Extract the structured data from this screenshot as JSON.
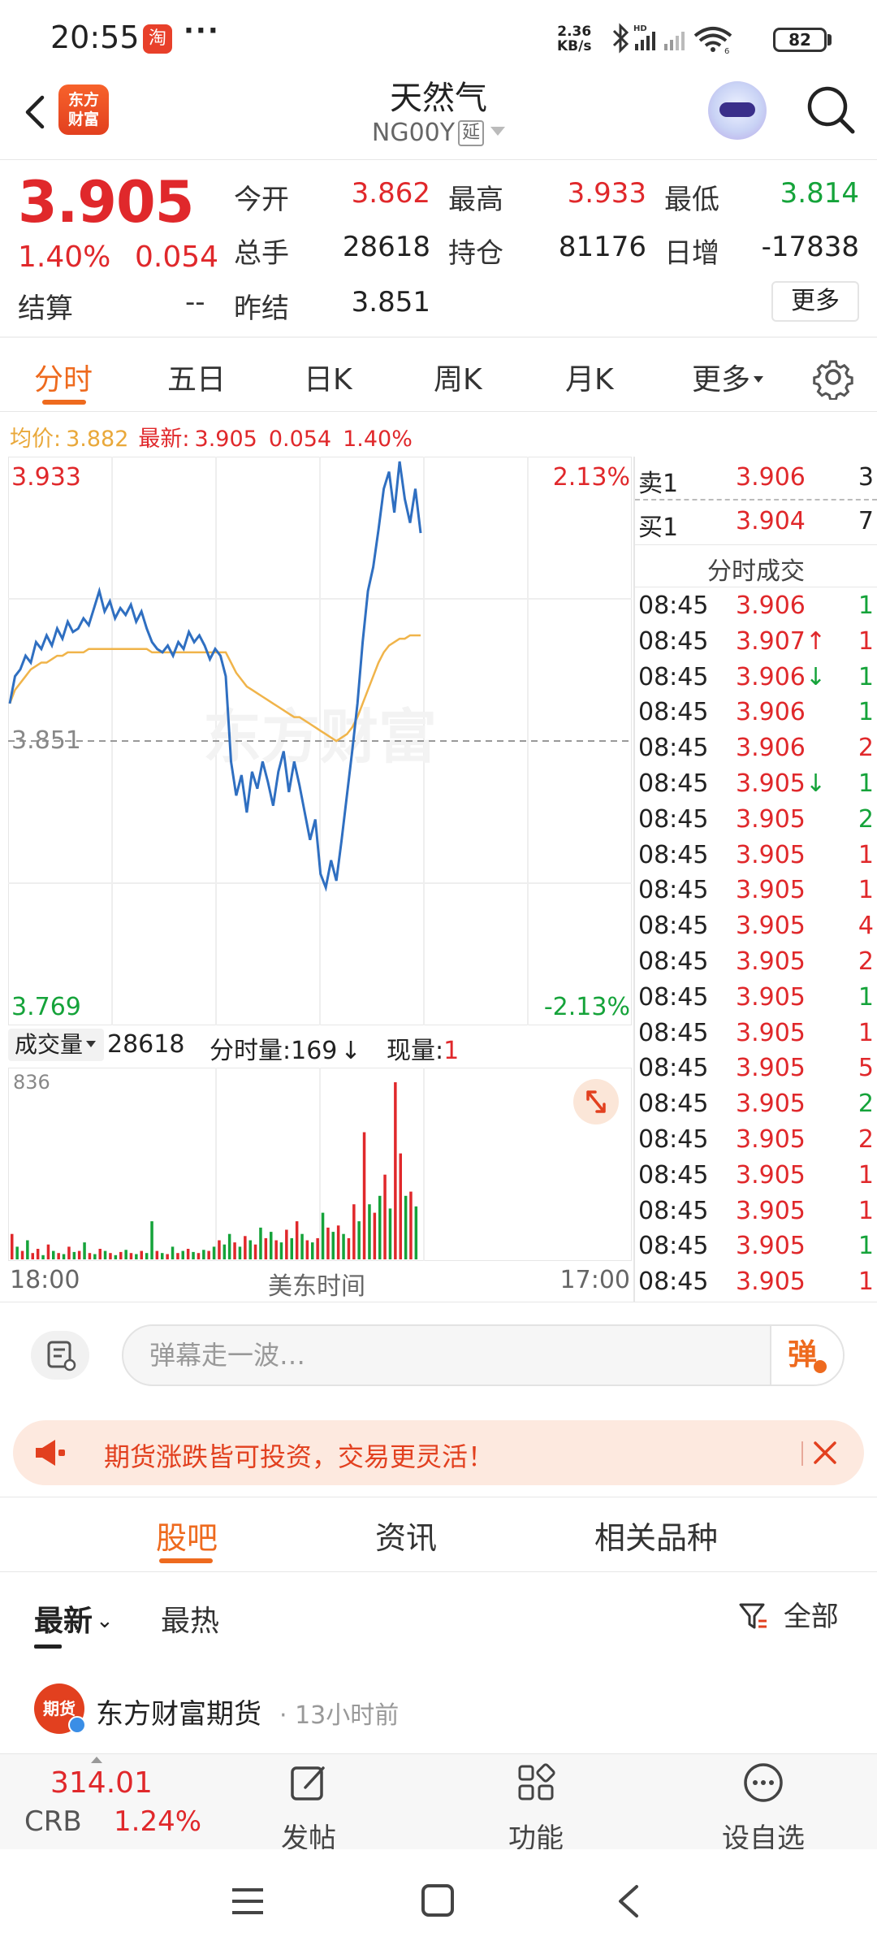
{
  "status_bar": {
    "time": "20:55",
    "app_notification": "淘",
    "dots": "···",
    "speed_value": "2.36",
    "speed_unit": "KB/s",
    "battery": "82"
  },
  "header": {
    "logo_line1": "东方",
    "logo_line2": "财富",
    "title": "天然气",
    "code": "NG00Y",
    "delay_tag": "延"
  },
  "quote": {
    "price": "3.905",
    "change_pct": "1.40%",
    "change": "0.054",
    "settle_label": "结算",
    "settle_value": "--",
    "open_label": "今开",
    "open_value": "3.862",
    "high_label": "最高",
    "high_value": "3.933",
    "low_label": "最低",
    "low_value": "3.814",
    "volume_label": "总手",
    "volume_value": "28618",
    "oi_label": "持仓",
    "oi_value": "81176",
    "daily_inc_label": "日增",
    "daily_inc_value": "-17838",
    "prev_settle_label": "昨结",
    "prev_settle_value": "3.851",
    "more_label": "更多"
  },
  "chart_tabs": [
    {
      "label": "分时"
    },
    {
      "label": "五日"
    },
    {
      "label": "日K"
    },
    {
      "label": "周K"
    },
    {
      "label": "月K"
    },
    {
      "label": "更多"
    }
  ],
  "avg_line": {
    "avg_label": "均价:",
    "avg_value": "3.882",
    "latest_label": "最新:",
    "latest_value": "3.905",
    "change": "0.054",
    "change_pct": "1.40%"
  },
  "price_axis": {
    "top": "3.933",
    "middle": "3.851",
    "bottom": "3.769",
    "top_pct": "2.13%",
    "bottom_pct": "-2.13%"
  },
  "volume_bar": {
    "select_label": "成交量",
    "total": "28618",
    "minute_vol_label": "分时量:",
    "minute_vol_value": "169",
    "minute_vol_arrow": "↓",
    "current_label": "现量:",
    "current_value": "1",
    "max_label": "836"
  },
  "time_axis": {
    "start": "18:00",
    "middle": "美东时间",
    "end": "17:00"
  },
  "watermark": "东方财富",
  "order_book": {
    "ask_label": "卖1",
    "ask_price": "3.906",
    "ask_vol": "3",
    "bid_label": "买1",
    "bid_price": "3.904",
    "bid_vol": "7",
    "trades_title": "分时成交"
  },
  "trades": [
    {
      "time": "08:45",
      "price": "3.906",
      "arrow": "",
      "vol": "1",
      "vol_color": "green"
    },
    {
      "time": "08:45",
      "price": "3.907",
      "arrow": "↑",
      "vol": "1",
      "vol_color": "red"
    },
    {
      "time": "08:45",
      "price": "3.906",
      "arrow": "↓",
      "vol": "1",
      "vol_color": "green"
    },
    {
      "time": "08:45",
      "price": "3.906",
      "arrow": "",
      "vol": "1",
      "vol_color": "green"
    },
    {
      "time": "08:45",
      "price": "3.906",
      "arrow": "",
      "vol": "2",
      "vol_color": "red"
    },
    {
      "time": "08:45",
      "price": "3.905",
      "arrow": "↓",
      "vol": "1",
      "vol_color": "green"
    },
    {
      "time": "08:45",
      "price": "3.905",
      "arrow": "",
      "vol": "2",
      "vol_color": "green"
    },
    {
      "time": "08:45",
      "price": "3.905",
      "arrow": "",
      "vol": "1",
      "vol_color": "red"
    },
    {
      "time": "08:45",
      "price": "3.905",
      "arrow": "",
      "vol": "1",
      "vol_color": "red"
    },
    {
      "time": "08:45",
      "price": "3.905",
      "arrow": "",
      "vol": "4",
      "vol_color": "red"
    },
    {
      "time": "08:45",
      "price": "3.905",
      "arrow": "",
      "vol": "2",
      "vol_color": "red"
    },
    {
      "time": "08:45",
      "price": "3.905",
      "arrow": "",
      "vol": "1",
      "vol_color": "green"
    },
    {
      "time": "08:45",
      "price": "3.905",
      "arrow": "",
      "vol": "1",
      "vol_color": "red"
    },
    {
      "time": "08:45",
      "price": "3.905",
      "arrow": "",
      "vol": "5",
      "vol_color": "red"
    },
    {
      "time": "08:45",
      "price": "3.905",
      "arrow": "",
      "vol": "2",
      "vol_color": "green"
    },
    {
      "time": "08:45",
      "price": "3.905",
      "arrow": "",
      "vol": "2",
      "vol_color": "red"
    },
    {
      "time": "08:45",
      "price": "3.905",
      "arrow": "",
      "vol": "1",
      "vol_color": "red"
    },
    {
      "time": "08:45",
      "price": "3.905",
      "arrow": "",
      "vol": "1",
      "vol_color": "red"
    },
    {
      "time": "08:45",
      "price": "3.905",
      "arrow": "",
      "vol": "1",
      "vol_color": "green"
    },
    {
      "time": "08:45",
      "price": "3.905",
      "arrow": "",
      "vol": "1",
      "vol_color": "red"
    }
  ],
  "comment": {
    "placeholder": "弹幕走一波…",
    "danmu_label": "弹"
  },
  "promo": {
    "text": "期货涨跌皆可投资，交易更灵活！"
  },
  "news_tabs": [
    {
      "label": "股吧"
    },
    {
      "label": "资讯"
    },
    {
      "label": "相关品种"
    }
  ],
  "sort": {
    "latest": "最新",
    "hot": "最热",
    "filter": "全部"
  },
  "post": {
    "avatar_text": "期货",
    "author": "东方财富期货",
    "time": "· 13小时前"
  },
  "bottom_bar": {
    "crb_value": "314.01",
    "crb_label": "CRB",
    "crb_pct": "1.24%",
    "post_label": "发帖",
    "function_label": "功能",
    "watchlist_label": "设自选"
  },
  "colors": {
    "up": "#e0282b",
    "down": "#15a33a",
    "accent": "#ee6a1e",
    "price_line": "#2f6fc1",
    "avg_line": "#f0b44a"
  },
  "chart_data": {
    "type": "line",
    "ylim": [
      3.769,
      3.933
    ],
    "reference": 3.851,
    "series": [
      {
        "values": [
          3.862,
          3.87,
          3.872,
          3.876,
          3.874,
          3.88,
          3.878,
          3.882,
          3.879,
          3.884,
          3.881,
          3.886,
          3.883,
          3.884,
          3.887,
          3.885,
          3.89,
          3.895,
          3.889,
          3.892,
          3.887,
          3.89,
          3.888,
          3.891,
          3.886,
          3.889,
          3.884,
          3.88,
          3.878,
          3.877,
          3.879,
          3.876,
          3.88,
          3.878,
          3.883,
          3.88,
          3.882,
          3.879,
          3.875,
          3.878,
          3.876,
          3.87,
          3.845,
          3.835,
          3.841,
          3.83,
          3.842,
          3.837,
          3.845,
          3.839,
          3.832,
          3.842,
          3.848,
          3.836,
          3.845,
          3.838,
          3.83,
          3.822,
          3.828,
          3.812,
          3.808,
          3.816,
          3.81,
          3.822,
          3.835,
          3.848,
          3.862,
          3.88,
          3.895,
          3.902,
          3.913,
          3.925,
          3.93,
          3.918,
          3.933,
          3.922,
          3.915,
          3.925,
          3.912
        ]
      },
      {
        "values": [
          3.862,
          3.866,
          3.868,
          3.87,
          3.872,
          3.873,
          3.874,
          3.874,
          3.875,
          3.876,
          3.876,
          3.877,
          3.877,
          3.877,
          3.877,
          3.878,
          3.878,
          3.878,
          3.878,
          3.878,
          3.878,
          3.878,
          3.878,
          3.878,
          3.878,
          3.878,
          3.878,
          3.877,
          3.877,
          3.877,
          3.877,
          3.877,
          3.877,
          3.877,
          3.877,
          3.877,
          3.877,
          3.877,
          3.877,
          3.877,
          3.877,
          3.877,
          3.874,
          3.871,
          3.869,
          3.867,
          3.866,
          3.865,
          3.864,
          3.863,
          3.862,
          3.861,
          3.86,
          3.859,
          3.858,
          3.858,
          3.857,
          3.856,
          3.855,
          3.854,
          3.853,
          3.852,
          3.851,
          3.852,
          3.853,
          3.855,
          3.858,
          3.862,
          3.866,
          3.87,
          3.874,
          3.877,
          3.879,
          3.88,
          3.881,
          3.881,
          3.882,
          3.882,
          3.882
        ]
      }
    ],
    "volume": {
      "max": 836,
      "values": [
        120,
        60,
        40,
        90,
        30,
        50,
        20,
        70,
        40,
        30,
        25,
        60,
        35,
        40,
        80,
        30,
        25,
        50,
        40,
        30,
        20,
        35,
        45,
        30,
        25,
        40,
        30,
        180,
        40,
        30,
        25,
        60,
        30,
        40,
        50,
        35,
        30,
        45,
        40,
        60,
        90,
        70,
        120,
        80,
        60,
        110,
        90,
        70,
        150,
        100,
        130,
        90,
        80,
        140,
        100,
        180,
        120,
        90,
        80,
        100,
        220,
        150,
        130,
        160,
        120,
        100,
        260,
        180,
        600,
        260,
        220,
        300,
        400,
        240,
        836,
        500,
        300,
        320,
        250
      ],
      "colors": [
        "r",
        "g",
        "r",
        "g",
        "r",
        "r",
        "g",
        "r",
        "g",
        "r",
        "g",
        "r",
        "g",
        "r",
        "g",
        "r",
        "g",
        "r",
        "g",
        "r",
        "g",
        "r",
        "g",
        "r",
        "g",
        "r",
        "g",
        "g",
        "r",
        "g",
        "r",
        "g",
        "r",
        "g",
        "r",
        "g",
        "r",
        "g",
        "r",
        "g",
        "r",
        "g",
        "g",
        "r",
        "g",
        "r",
        "g",
        "r",
        "g",
        "r",
        "g",
        "r",
        "g",
        "r",
        "g",
        "r",
        "g",
        "r",
        "g",
        "r",
        "g",
        "r",
        "g",
        "r",
        "g",
        "r",
        "r",
        "g",
        "r",
        "g",
        "r",
        "g",
        "r",
        "g",
        "r",
        "r",
        "g",
        "r",
        "g"
      ]
    }
  }
}
